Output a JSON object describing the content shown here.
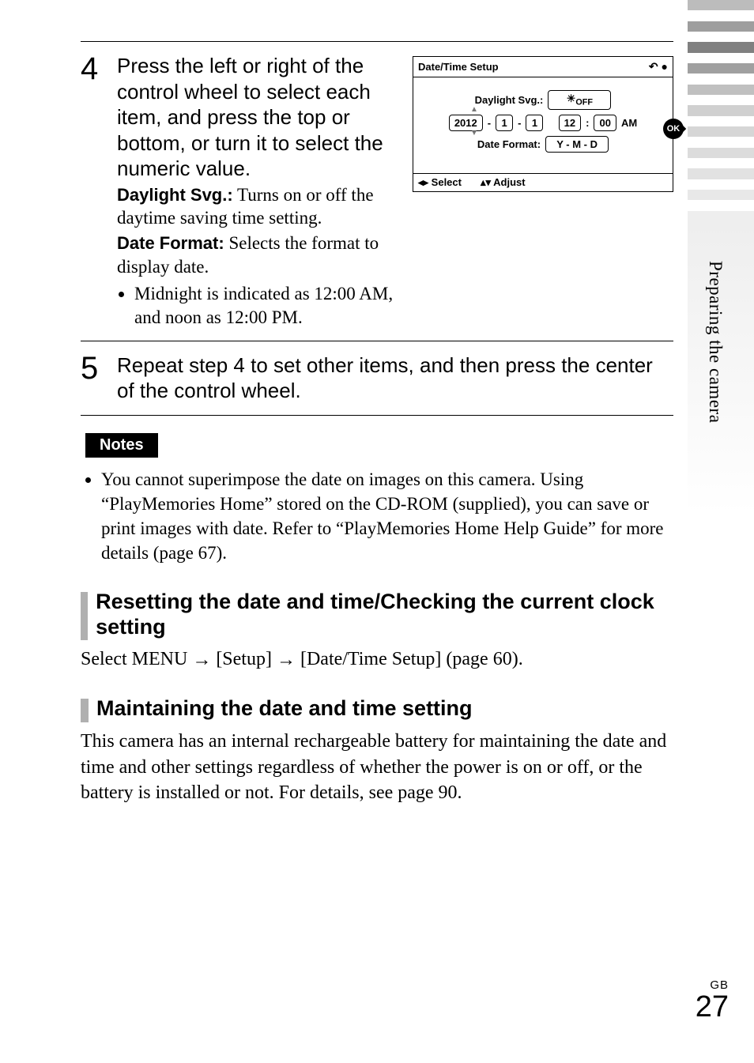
{
  "side_tab": "Preparing the camera",
  "footer": {
    "region": "GB",
    "page": "27"
  },
  "step4": {
    "num": "4",
    "lead": "Press the left or right of the control wheel to select each item, and press the top or bottom, or turn it to select the numeric value.",
    "def1_label": "Daylight Svg.:",
    "def1_text": " Turns on or off the daytime saving time setting.",
    "def2_label": "Date Format:",
    "def2_text": " Selects the format to display date.",
    "bullet": "Midnight is indicated as 12:00 AM, and noon as 12:00 PM."
  },
  "step5": {
    "num": "5",
    "lead": "Repeat step 4 to set other items, and then press the center of the control wheel."
  },
  "dts": {
    "title": "Date/Time Setup",
    "row1_label": "Daylight Svg.:",
    "row1_value": "OFF",
    "year": "2012",
    "month": "1",
    "day": "1",
    "hour": "12",
    "min": "00",
    "ampm": "AM",
    "row3_label": "Date Format:",
    "row3_value": "Y - M - D",
    "foot_select": "Select",
    "foot_adjust": "Adjust",
    "ok": "OK"
  },
  "notes": {
    "heading": "Notes",
    "item": "You cannot superimpose the date on images on this camera. Using “PlayMemories Home” stored on the CD-ROM (supplied), you can save or print images with date. Refer to “PlayMemories Home Help Guide” for more details (page 67)."
  },
  "sec1": {
    "heading": "Resetting the date and time/Checking the current clock setting",
    "body_prefix": "Select MENU ",
    "body_mid1": " [Setup] ",
    "body_mid2": " [Date/Time Setup] (page 60).",
    "arrow": "→"
  },
  "sec2": {
    "heading": "Maintaining the date and time setting",
    "body": "This camera has an internal rechargeable battery for maintaining the date and time and other settings regardless of whether the power is on or off, or the battery is installed or not. For details, see page 90."
  }
}
